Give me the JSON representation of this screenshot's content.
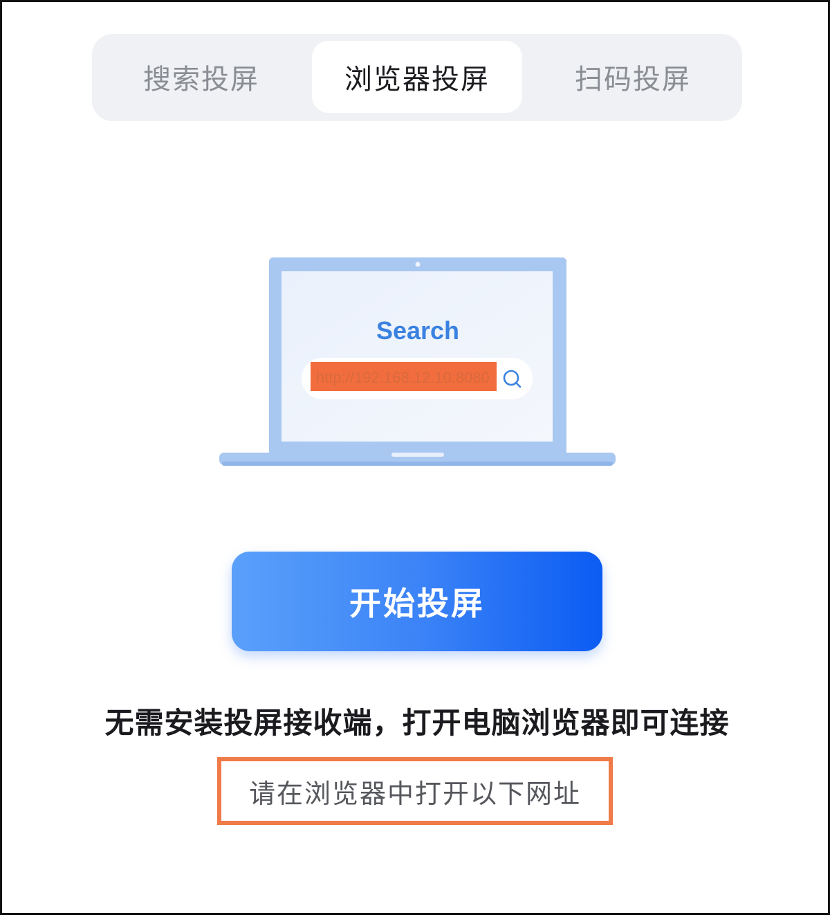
{
  "tabs": [
    {
      "label": "搜索投屏",
      "active": false
    },
    {
      "label": "浏览器投屏",
      "active": true
    },
    {
      "label": "扫码投屏",
      "active": false
    }
  ],
  "illustration": {
    "search_title": "Search",
    "url_value": "http://192.168.12.10:8080",
    "search_icon": "search-icon",
    "redaction_color": "#f26d3d"
  },
  "start_button": {
    "label": "开始投屏"
  },
  "description": "无需安装投屏接收端，打开电脑浏览器即可连接",
  "hint": "请在浏览器中打开以下网址",
  "colors": {
    "accent_blue": "#2f7df6",
    "highlight_orange": "#f07a48",
    "tab_bg": "#eff1f4"
  }
}
